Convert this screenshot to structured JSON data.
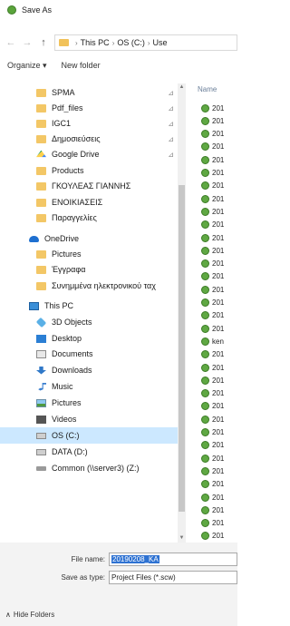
{
  "window": {
    "title": "Save As"
  },
  "navigation": {
    "back_glyph": "←",
    "forward_glyph": "→",
    "up_glyph": "↑",
    "breadcrumbs": [
      "This PC",
      "OS (C:)",
      "Use"
    ]
  },
  "toolbar": {
    "organize_label": "Organize ▾",
    "new_folder_label": "New folder"
  },
  "nav_pane": {
    "items": [
      {
        "label": "SPMA",
        "icon": "folder-icon",
        "pinned": true
      },
      {
        "label": "Pdf_files",
        "icon": "folder-icon",
        "pinned": true
      },
      {
        "label": "IGC1",
        "icon": "folder-icon",
        "pinned": true
      },
      {
        "label": "Δημοσιεύσεις",
        "icon": "folder-icon",
        "pinned": true
      },
      {
        "label": "Google Drive",
        "icon": "google-drive-icon",
        "pinned": true
      },
      {
        "label": "Products",
        "icon": "folder-icon",
        "pinned": false
      },
      {
        "label": "ΓΚΟΥΛΕΑΣ ΓΙΑΝΝΗΣ",
        "icon": "folder-icon",
        "pinned": false
      },
      {
        "label": "ΕΝΟΙΚΙΑΣΕΙΣ",
        "icon": "folder-icon",
        "pinned": false
      },
      {
        "label": "Παραγγελίες",
        "icon": "folder-icon",
        "pinned": false
      },
      {
        "label": "OneDrive",
        "icon": "onedrive-icon",
        "pinned": false
      },
      {
        "label": "Pictures",
        "icon": "folder-icon",
        "pinned": false
      },
      {
        "label": "Έγγραφα",
        "icon": "folder-icon",
        "pinned": false
      },
      {
        "label": "Συνημμένα ηλεκτρονικού ταχ",
        "icon": "folder-icon",
        "pinned": false
      },
      {
        "label": "This PC",
        "icon": "this-pc-icon",
        "pinned": false
      },
      {
        "label": "3D Objects",
        "icon": "3d-objects-icon",
        "pinned": false
      },
      {
        "label": "Desktop",
        "icon": "desktop-icon",
        "pinned": false
      },
      {
        "label": "Documents",
        "icon": "documents-icon",
        "pinned": false
      },
      {
        "label": "Downloads",
        "icon": "downloads-icon",
        "pinned": false
      },
      {
        "label": "Music",
        "icon": "music-icon",
        "pinned": false
      },
      {
        "label": "Pictures",
        "icon": "pictures-icon",
        "pinned": false
      },
      {
        "label": "Videos",
        "icon": "videos-icon",
        "pinned": false
      },
      {
        "label": "OS (C:)",
        "icon": "drive-icon",
        "pinned": false,
        "selected": true
      },
      {
        "label": "DATA (D:)",
        "icon": "drive-icon",
        "pinned": false
      },
      {
        "label": "Common (\\\\server3) (Z:)",
        "icon": "network-drive-icon",
        "pinned": false
      }
    ]
  },
  "file_list": {
    "column_header": "Name",
    "files": [
      "201",
      "201",
      "201",
      "201",
      "201",
      "201",
      "201",
      "201",
      "201",
      "201",
      "201",
      "201",
      "201",
      "201",
      "201",
      "201",
      "201",
      "201",
      "ken",
      "201",
      "201",
      "201",
      "201",
      "201",
      "201",
      "201",
      "201",
      "201",
      "201",
      "201",
      "201",
      "201",
      "201",
      "201",
      "201"
    ]
  },
  "save_panel": {
    "file_name_label": "File name:",
    "file_name_value": "20190208_KA",
    "save_as_type_label": "Save as type:",
    "save_as_type_value": "Project Files (*.scw)",
    "hide_folders_label": "Hide Folders"
  },
  "colors": {
    "selection": "#cce8ff",
    "text_highlight": "#2e72d2",
    "project_file_icon": "#5fa843"
  }
}
